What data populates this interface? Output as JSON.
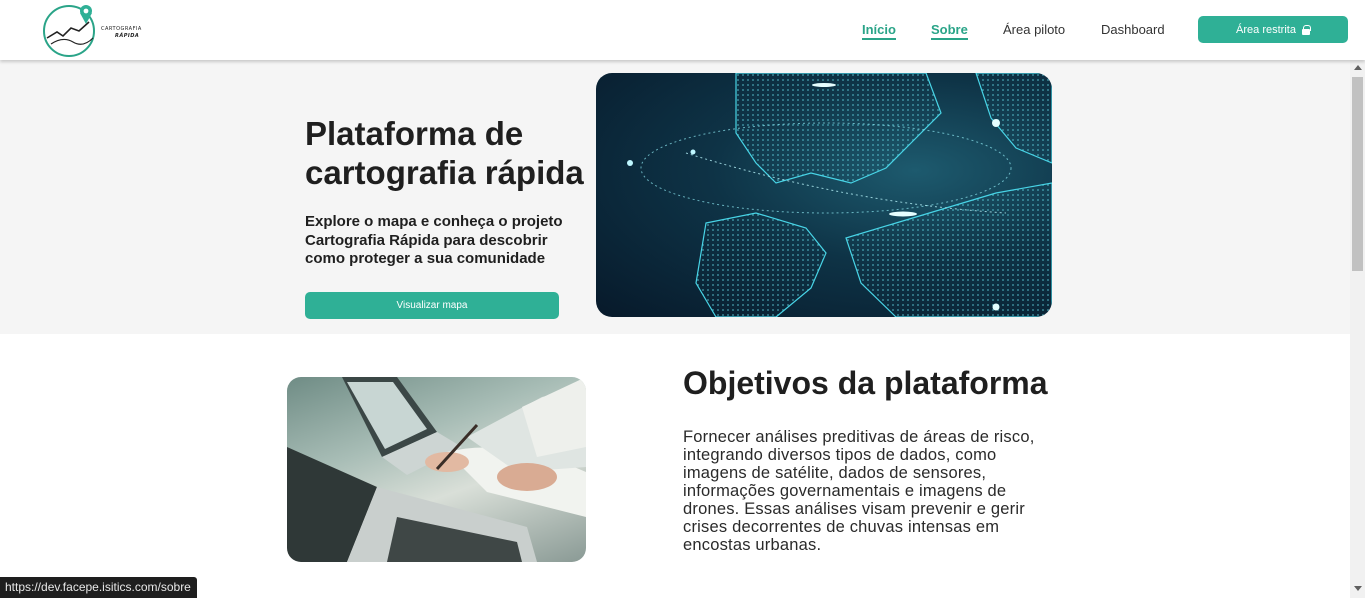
{
  "header": {
    "logo": {
      "line1": "CARTOGRAFIA",
      "line2": "RÁPIDA"
    },
    "nav": [
      {
        "label": "Início",
        "active": true
      },
      {
        "label": "Sobre",
        "active": true
      },
      {
        "label": "Área piloto",
        "active": false
      },
      {
        "label": "Dashboard",
        "active": false
      }
    ],
    "restricted_label": "Área restrita",
    "restricted_icon": "lock-icon"
  },
  "hero": {
    "title": "Plataforma de cartografia rápida",
    "subtitle": "Explore o mapa e conheça o projeto Cartografia Rápida para descobrir como proteger a sua comunidade",
    "button_label": "Visualizar mapa"
  },
  "objectives": {
    "title": "Objetivos da plataforma",
    "text": "Fornecer análises preditivas de áreas de risco, integrando diversos tipos de dados, como imagens de satélite, dados de sensores, informações governamentais e imagens de drones. Essas análises visam prevenir e gerir crises decorrentes de chuvas intensas em encostas urbanas."
  },
  "status_bar": {
    "url": "https://dev.facepe.isitics.com/sobre"
  },
  "colors": {
    "accent": "#2fb096",
    "hero_bg": "#f5f5f5",
    "text": "#1f1f1f"
  }
}
